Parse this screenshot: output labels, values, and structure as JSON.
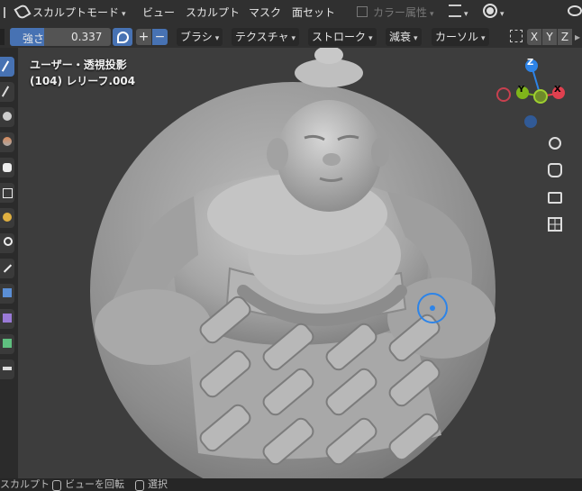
{
  "header": {
    "mode": "スカルプトモード",
    "menu": [
      "ビュー",
      "スカルプト",
      "マスク",
      "面セット"
    ],
    "color_attribute": "カラー属性"
  },
  "tool_settings": {
    "strength_label": "強さ",
    "strength_value": "0.337",
    "dropdowns": [
      "ブラシ",
      "テクスチャ",
      "ストローク",
      "減衰",
      "カーソル"
    ],
    "axes": [
      "X",
      "Y",
      "Z"
    ]
  },
  "viewport": {
    "view_name": "ユーザー・透視投影",
    "object_name": "(104) レリーフ.004"
  },
  "gizmo": {
    "z": "Z",
    "y": "Y",
    "x": "X"
  },
  "statusbar": {
    "mode": "スカルプト",
    "rotate_view": "ビューを回転",
    "select": "選択"
  },
  "icons": {
    "brush": "brush-icon",
    "pressure": "pen-pressure-icon",
    "zoom": "zoom-icon",
    "pan": "hand-icon",
    "camera": "camera-icon",
    "grid": "grid-icon"
  },
  "colors": {
    "accent": "#4772b3",
    "header": "#303030",
    "viewport": "#3d3d3d",
    "axis_x": "#e0404f",
    "axis_y": "#7fb51a",
    "axis_z": "#2d84e8"
  }
}
